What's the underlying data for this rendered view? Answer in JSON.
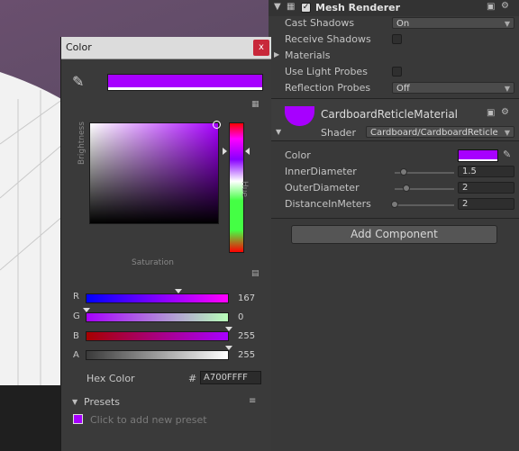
{
  "inspector": {
    "component_title": "Mesh Renderer",
    "component_enabled": true,
    "cast_shadows": {
      "label": "Cast Shadows",
      "value": "On"
    },
    "receive_shadows": {
      "label": "Receive Shadows",
      "checked": false
    },
    "materials_label": "Materials",
    "use_light_probes": {
      "label": "Use Light Probes",
      "checked": false
    },
    "reflection_probes": {
      "label": "Reflection Probes",
      "value": "Off"
    },
    "material": {
      "name": "CardboardReticleMaterial",
      "shader_label": "Shader",
      "shader_value": "Cardboard/CardboardReticle",
      "swatch_color": "#A700FF"
    },
    "properties": [
      {
        "label": "Color",
        "color": "#A700FF"
      },
      {
        "label": "InnerDiameter",
        "value": "1.5",
        "slider": 0.15
      },
      {
        "label": "OuterDiameter",
        "value": "2",
        "slider": 0.2
      },
      {
        "label": "DistanceInMeters",
        "value": "2",
        "slider": 0.05
      }
    ],
    "add_component_label": "Add Component"
  },
  "picker": {
    "title": "Color",
    "close_label": "x",
    "current_color": "#A700FF",
    "brightness_label": "Brightness",
    "saturation_label": "Saturation",
    "hue_label": "Hue",
    "channels": [
      {
        "label": "R",
        "value": "167",
        "fraction": 0.655
      },
      {
        "label": "G",
        "value": "0",
        "fraction": 0.0
      },
      {
        "label": "B",
        "value": "255",
        "fraction": 1.0
      },
      {
        "label": "A",
        "value": "255",
        "fraction": 1.0
      }
    ],
    "hex_label": "Hex Color",
    "hex_hash": "#",
    "hex_value": "A700FFFF",
    "presets_label": "Presets",
    "presets_hint": "Click to add new preset"
  },
  "colors": {
    "accent": "#A700FF",
    "close": "#C8283A"
  }
}
